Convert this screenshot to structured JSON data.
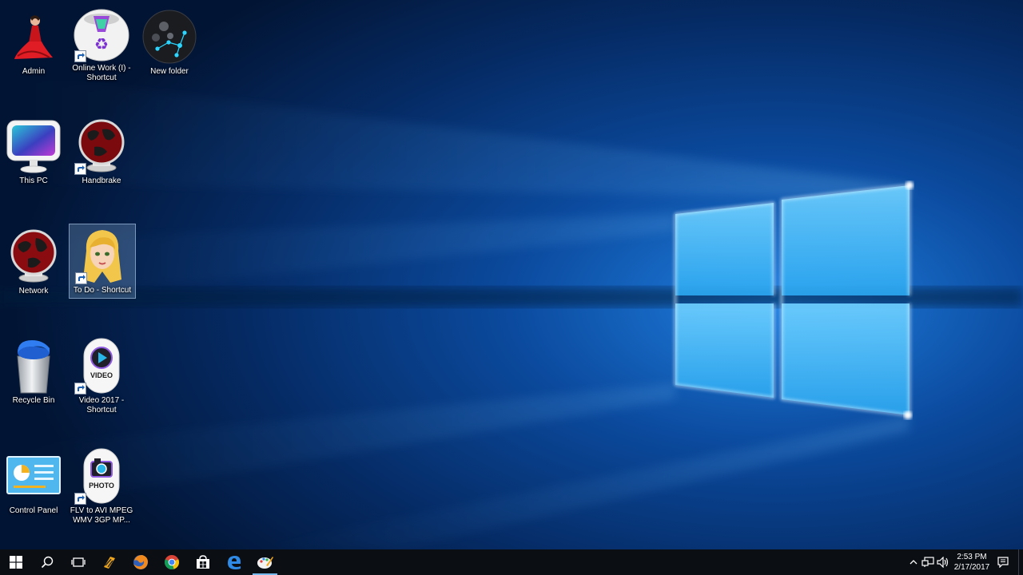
{
  "desktop": {
    "icons": [
      {
        "label": "Admin",
        "icon": "admin-avatar-icon",
        "shortcut": false
      },
      {
        "label": "Online Work (I) - Shortcut",
        "icon": "recycle-jar-icon",
        "shortcut": true
      },
      {
        "label": "New folder",
        "icon": "folder-orb-icon",
        "shortcut": false
      },
      {
        "label": "This PC",
        "icon": "monitor-icon",
        "shortcut": false
      },
      {
        "label": "Handbrake",
        "icon": "globe-orb-icon",
        "shortcut": true
      },
      {
        "label": "Network",
        "icon": "network-globe-icon",
        "shortcut": false
      },
      {
        "label": "To Do - Shortcut",
        "icon": "todo-girl-icon",
        "shortcut": true,
        "selected": true
      },
      {
        "label": "Recycle Bin",
        "icon": "recycle-bin-icon",
        "shortcut": false
      },
      {
        "label": "Video 2017 - Shortcut",
        "icon": "video-app-icon",
        "shortcut": true,
        "badge": "VIDEO"
      },
      {
        "label": "Control Panel",
        "icon": "control-panel-icon",
        "shortcut": false
      },
      {
        "label": "FLV to AVI MPEG WMV 3GP MP...",
        "icon": "photo-app-icon",
        "shortcut": true,
        "badge": "PHOTO"
      }
    ]
  },
  "taskbar": {
    "buttons": [
      {
        "icon": "windows-start-icon"
      },
      {
        "icon": "search-icon"
      },
      {
        "icon": "task-view-icon"
      },
      {
        "icon": "pinned-app-icon"
      },
      {
        "icon": "firefox-icon"
      },
      {
        "icon": "chrome-icon"
      },
      {
        "icon": "store-icon"
      },
      {
        "icon": "edge-icon"
      },
      {
        "icon": "paint-icon"
      }
    ],
    "tray": {
      "icons": [
        "chevron-up-icon",
        "network-icon",
        "volume-icon",
        "action-center-icon"
      ],
      "time": "2:53 PM",
      "date": "2/17/2017"
    }
  },
  "colors": {
    "accent": "#1e90ff",
    "taskbar": "#0b0e13",
    "active_indicator": "#76b9ed"
  }
}
